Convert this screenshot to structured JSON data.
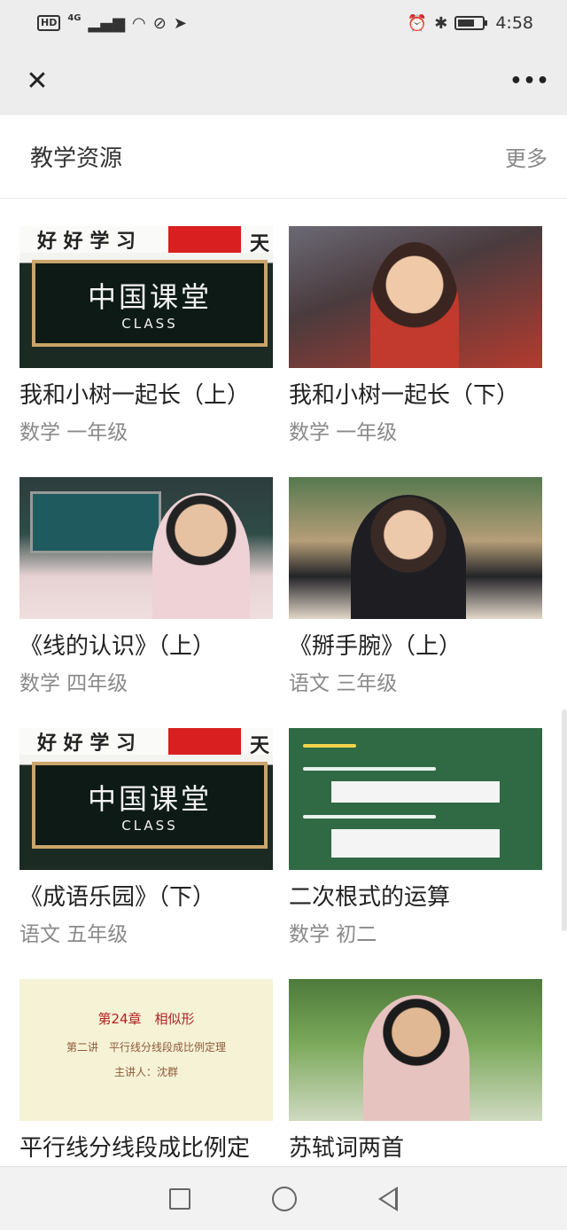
{
  "status_bar": {
    "hd": "HD",
    "network": "4G",
    "time": "4:58"
  },
  "nav": {
    "close_icon": "close-icon",
    "more_icon": "more-horizontal-icon"
  },
  "section": {
    "title": "教学资源",
    "more": "更多",
    "accent_color": "#ff4f8b"
  },
  "cards": [
    {
      "title": "我和小树一起长（上）",
      "subtitle": "数学 一年级",
      "thumb_banner": "好 好 学 习",
      "thumb_banner2": "天",
      "thumb_board": "中国课堂",
      "thumb_board_en": "CLASS"
    },
    {
      "title": "我和小树一起长（下）",
      "subtitle": "数学 一年级"
    },
    {
      "title": "《线的认识》（上）",
      "subtitle": "数学 四年级"
    },
    {
      "title": "《掰手腕》（上）",
      "subtitle": "语文 三年级"
    },
    {
      "title": "《成语乐园》（下）",
      "subtitle": "语文 五年级",
      "thumb_banner": "好 好 学 习",
      "thumb_banner2": "天",
      "thumb_board": "中国课堂",
      "thumb_board_en": "CLASS"
    },
    {
      "title": "二次根式的运算",
      "subtitle": "数学 初二"
    },
    {
      "title": "平行线分线段成比例定",
      "subtitle": "",
      "thumb_line1": "第24章　相似形",
      "thumb_line2": "第二讲　平行线分线段成比例定理",
      "thumb_line3": "主讲人：沈群"
    },
    {
      "title": "苏轼词两首",
      "subtitle": ""
    }
  ]
}
